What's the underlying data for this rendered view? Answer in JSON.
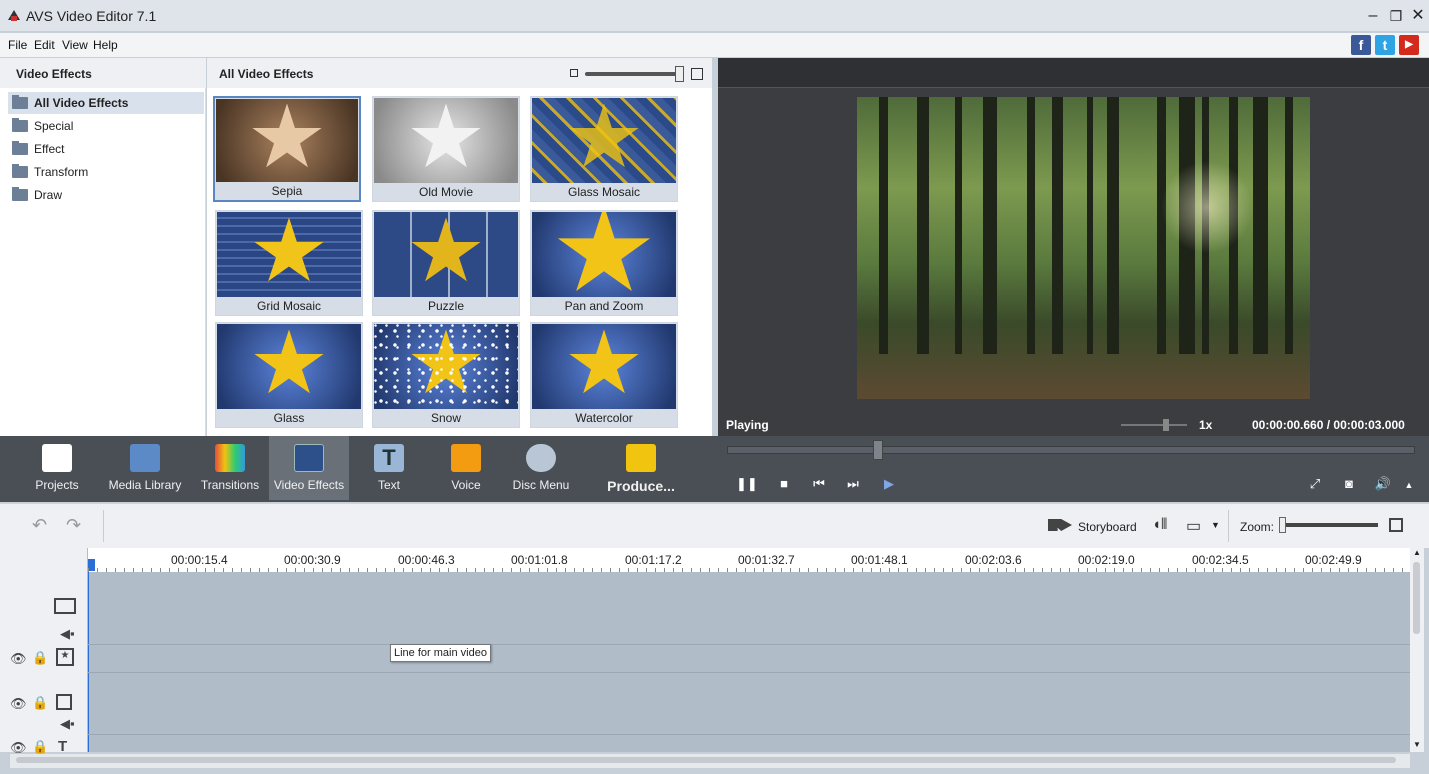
{
  "window": {
    "title": "AVS Video Editor 7.1",
    "controls": [
      "minimize-icon",
      "restore-icon",
      "close-icon"
    ]
  },
  "menu": [
    "File",
    "Edit",
    "View",
    "Help"
  ],
  "social": [
    {
      "name": "facebook",
      "glyph": "f",
      "color": "#3b5998"
    },
    {
      "name": "twitter",
      "glyph": "t",
      "color": "#2fa4e5"
    },
    {
      "name": "youtube",
      "glyph": "▶",
      "color": "#d32a1d"
    }
  ],
  "left_panel": {
    "title": "Video Effects",
    "items": [
      {
        "label": "All Video Effects",
        "selected": true
      },
      {
        "label": "Special",
        "selected": false
      },
      {
        "label": "Effect",
        "selected": false
      },
      {
        "label": "Transform",
        "selected": false
      },
      {
        "label": "Draw",
        "selected": false
      }
    ]
  },
  "gallery": {
    "title": "All Video Effects",
    "effects": [
      "Sepia",
      "Old Movie",
      "Glass Mosaic",
      "Grid Mosaic",
      "Puzzle",
      "Pan and Zoom",
      "Glass",
      "Snow",
      "Watercolor"
    ],
    "selected": "Sepia"
  },
  "preview": {
    "status": "Playing",
    "speed": "1x",
    "time_current": "00:00:00.660",
    "time_separator": "/",
    "time_total": "00:00:03.000"
  },
  "tools": [
    "Projects",
    "Media Library",
    "Transitions",
    "Video Effects",
    "Text",
    "Voice",
    "Disc Menu",
    "Produce..."
  ],
  "active_tool": "Video Effects",
  "timeline": {
    "storyboard_label": "Storyboard",
    "zoom_label": "Zoom:",
    "ticks": [
      "00:00:15.4",
      "00:00:30.9",
      "00:00:46.3",
      "00:01:01.8",
      "00:01:17.2",
      "00:01:32.7",
      "00:01:48.1",
      "00:02:03.6",
      "00:02:19.0",
      "00:02:34.5",
      "00:02:49.9"
    ],
    "tooltip": "Line for main video"
  }
}
